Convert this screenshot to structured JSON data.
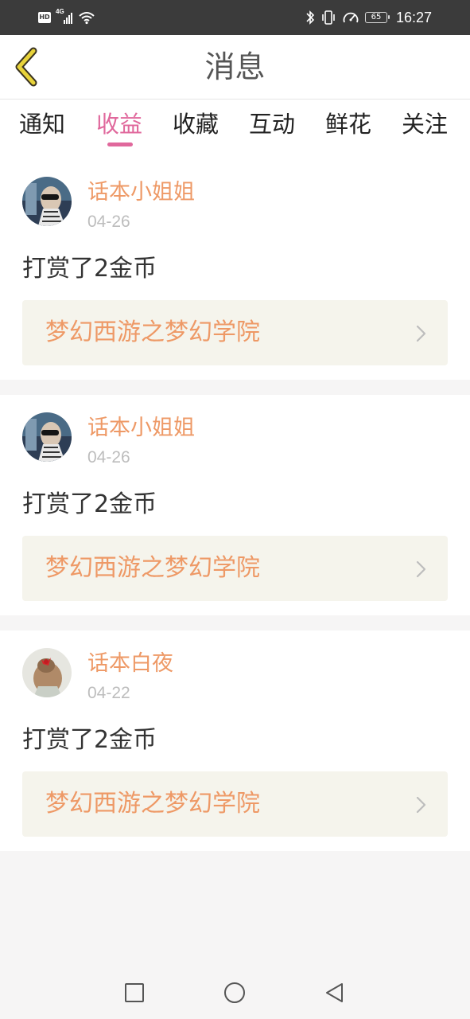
{
  "status_bar": {
    "hd_label": "HD",
    "network_label": "4G",
    "battery_level": "65",
    "time": "16:27",
    "icons": [
      "hd-icon",
      "signal-icon",
      "wifi-icon",
      "bluetooth-icon",
      "vibrate-icon",
      "speedometer-icon",
      "battery-icon"
    ]
  },
  "header": {
    "title": "消息",
    "back_icon": "chevron-left-icon",
    "accent_color": "#e8d33a"
  },
  "tabs": [
    {
      "label": "通知",
      "active": false
    },
    {
      "label": "收益",
      "active": true
    },
    {
      "label": "收藏",
      "active": false
    },
    {
      "label": "互动",
      "active": false
    },
    {
      "label": "鲜花",
      "active": false
    },
    {
      "label": "关注",
      "active": false
    }
  ],
  "active_tab_color": "#e0689c",
  "messages": [
    {
      "username": "话本小姐姐",
      "date": "04-26",
      "text": "打赏了2金币",
      "book_title": "梦幻西游之梦幻学院"
    },
    {
      "username": "话本小姐姐",
      "date": "04-26",
      "text": "打赏了2金币",
      "book_title": "梦幻西游之梦幻学院"
    },
    {
      "username": "话本白夜",
      "date": "04-22",
      "text": "打赏了2金币",
      "book_title": "梦幻西游之梦幻学院"
    }
  ],
  "colors": {
    "username": "#ee9966",
    "book_title": "#ee9966",
    "book_bg": "#f5f4ec",
    "date": "#bdbdbd"
  },
  "nav_bar": {
    "icons": [
      "recent-apps-icon",
      "home-icon",
      "back-icon"
    ]
  }
}
